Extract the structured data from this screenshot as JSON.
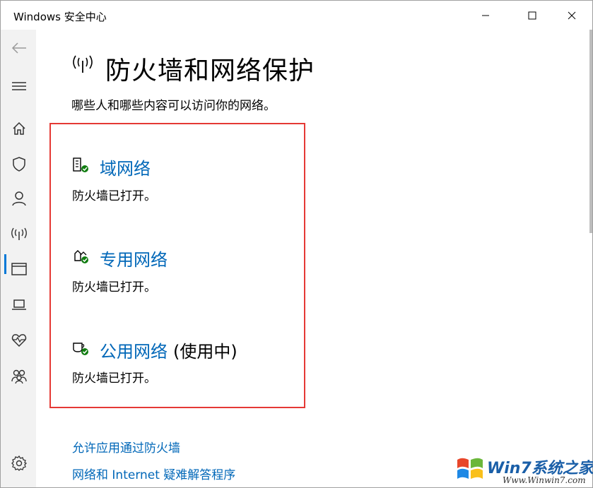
{
  "window": {
    "title": "Windows 安全中心"
  },
  "sidebar": {
    "items": [
      {
        "icon": "back-arrow-icon"
      },
      {
        "icon": "hamburger-menu-icon"
      },
      {
        "icon": "home-icon"
      },
      {
        "icon": "shield-icon"
      },
      {
        "icon": "account-icon"
      },
      {
        "icon": "wireless-signal-icon"
      },
      {
        "icon": "app-browser-icon"
      },
      {
        "icon": "laptop-icon"
      },
      {
        "icon": "heart-pulse-icon"
      },
      {
        "icon": "family-icon"
      },
      {
        "icon": "gear-icon"
      }
    ],
    "active_item": "wireless-signal-icon"
  },
  "main": {
    "title": "防火墙和网络保护",
    "subtitle": "哪些人和哪些内容可以访问你的网络。",
    "networks": [
      {
        "label": "域网络",
        "suffix": "",
        "status": "防火墙已打开。",
        "icon": "domain-network-icon"
      },
      {
        "label": "专用网络",
        "suffix": "",
        "status": "防火墙已打开。",
        "icon": "private-network-icon"
      },
      {
        "label": "公用网络",
        "suffix": "(使用中)",
        "status": "防火墙已打开。",
        "icon": "public-network-icon"
      }
    ],
    "links": [
      "允许应用通过防火墙",
      "网络和 Internet 疑难解答程序"
    ]
  },
  "watermark": {
    "logo_text": "Win7系统之家",
    "url": "Www.Winwin7.com"
  },
  "colors": {
    "accent": "#0067b8",
    "active_bar": "#0078d7",
    "highlight_border": "#e53935",
    "status_ok": "#107c10"
  }
}
